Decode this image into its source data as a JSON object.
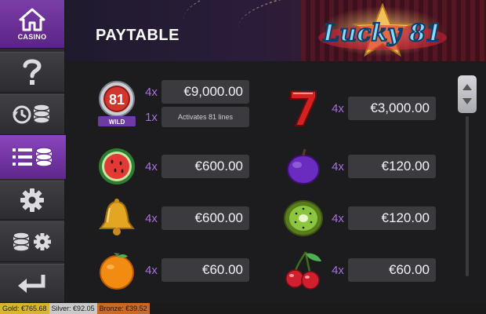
{
  "sidebar": {
    "casino_label": "CASINO",
    "icons": [
      "home-icon",
      "question-icon",
      "history-icon",
      "paytable-icon",
      "gear-icon",
      "bet-settings-icon",
      "back-arrow-icon"
    ]
  },
  "header": {
    "title": "PAYTABLE",
    "logo_text": "Lucky 81"
  },
  "paytable": {
    "left": [
      {
        "symbol": "wild-81-icon",
        "badge": "WILD",
        "multiplier": "4x",
        "amount": "€9,000.00",
        "multiplier2": "1x",
        "note": "Activates 81 lines"
      },
      {
        "symbol": "watermelon-icon",
        "multiplier": "4x",
        "amount": "€600.00"
      },
      {
        "symbol": "bell-icon",
        "multiplier": "4x",
        "amount": "€600.00"
      },
      {
        "symbol": "orange-icon",
        "multiplier": "4x",
        "amount": "€60.00"
      }
    ],
    "right": [
      {
        "symbol": "seven-icon",
        "multiplier": "4x",
        "amount": "€3,000.00"
      },
      {
        "symbol": "plum-icon",
        "multiplier": "4x",
        "amount": "€120.00"
      },
      {
        "symbol": "kiwi-icon",
        "multiplier": "4x",
        "amount": "€120.00"
      },
      {
        "symbol": "cherry-icon",
        "multiplier": "4x",
        "amount": "€60.00"
      }
    ]
  },
  "footer": {
    "gold": "Gold: €765.68",
    "silver": "Silver: €92.05",
    "bronze": "Bronze: €39.52"
  },
  "colors": {
    "accent": "#8a46bd",
    "multiplier": "#a771dd",
    "gold_bg": "#d8b531",
    "silver_bg": "#c9c9c9",
    "bronze_bg": "#c46a2b"
  }
}
